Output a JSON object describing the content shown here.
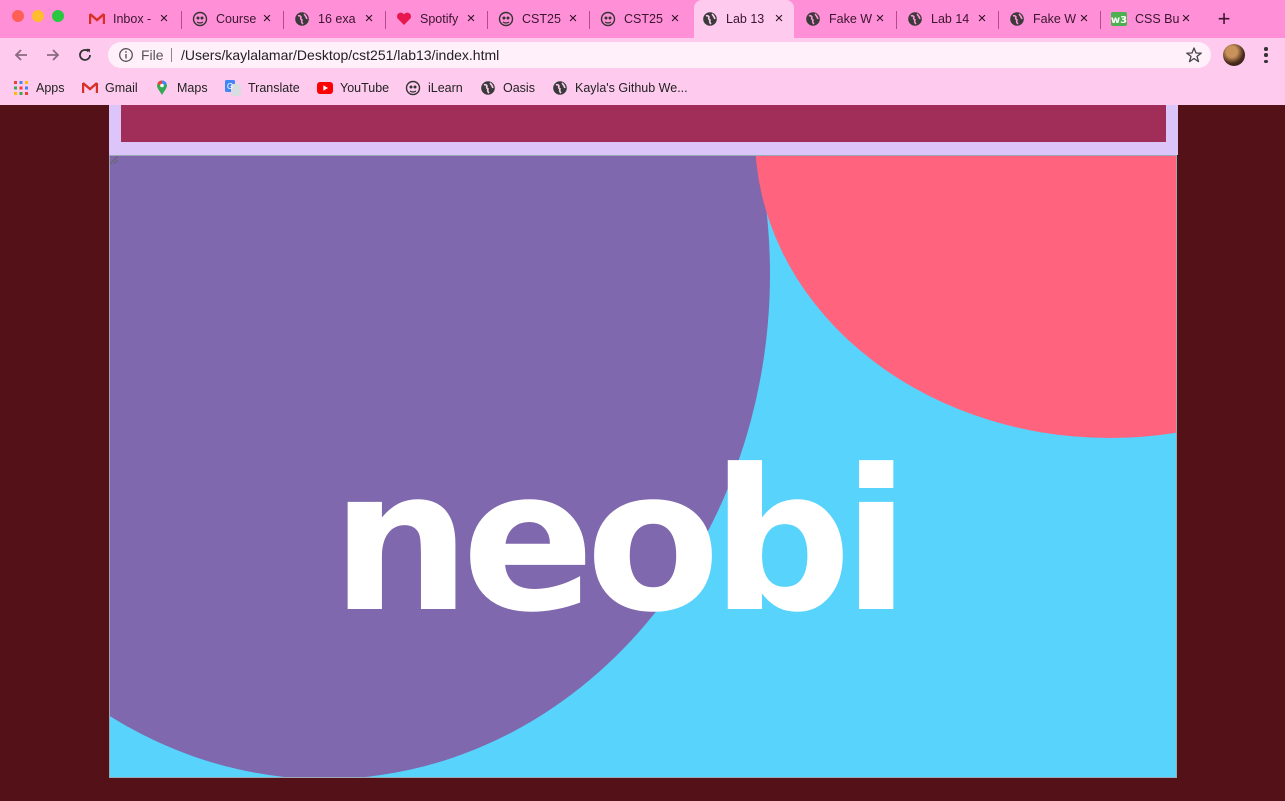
{
  "tabs": [
    {
      "title": "Inbox - ",
      "icon": "gmail-icon"
    },
    {
      "title": "Course",
      "icon": "ilearn-icon"
    },
    {
      "title": "16 exa",
      "icon": "globe-icon"
    },
    {
      "title": "Spotify",
      "icon": "heart-icon"
    },
    {
      "title": "CST25",
      "icon": "ilearn-icon"
    },
    {
      "title": "CST25",
      "icon": "ilearn-icon"
    },
    {
      "title": "Lab 13",
      "icon": "globe-icon",
      "active": true
    },
    {
      "title": "Fake W",
      "icon": "globe-icon"
    },
    {
      "title": "Lab 14",
      "icon": "globe-icon"
    },
    {
      "title": "Fake W",
      "icon": "globe-icon"
    },
    {
      "title": "CSS Bu",
      "icon": "w3schools-icon"
    }
  ],
  "new_tab_label": "+",
  "address_bar": {
    "scheme_label": "File",
    "url": "/Users/kaylalamar/Desktop/cst251/lab13/index.html"
  },
  "bookmarks": [
    {
      "label": "Apps",
      "icon": "apps-grid-icon"
    },
    {
      "label": "Gmail",
      "icon": "gmail-icon"
    },
    {
      "label": "Maps",
      "icon": "maps-pin-icon"
    },
    {
      "label": "Translate",
      "icon": "translate-icon"
    },
    {
      "label": "YouTube",
      "icon": "youtube-icon"
    },
    {
      "label": "iLearn",
      "icon": "ilearn-icon"
    },
    {
      "label": "Oasis",
      "icon": "globe-icon"
    },
    {
      "label": "Kayla's Github We...",
      "icon": "globe-icon"
    }
  ],
  "hero": {
    "logo_text": "neobi"
  },
  "colors": {
    "page_background": "#541117",
    "tab_strip": "#ff8fd6",
    "toolbar": "#fecbef",
    "header_bar": "#a02e58",
    "header_border": "#dcc6f9",
    "hero_sky": "#58d3fb",
    "hero_purple": "#7f68ad",
    "hero_coral": "#ff637d",
    "logo": "#ffffff"
  }
}
